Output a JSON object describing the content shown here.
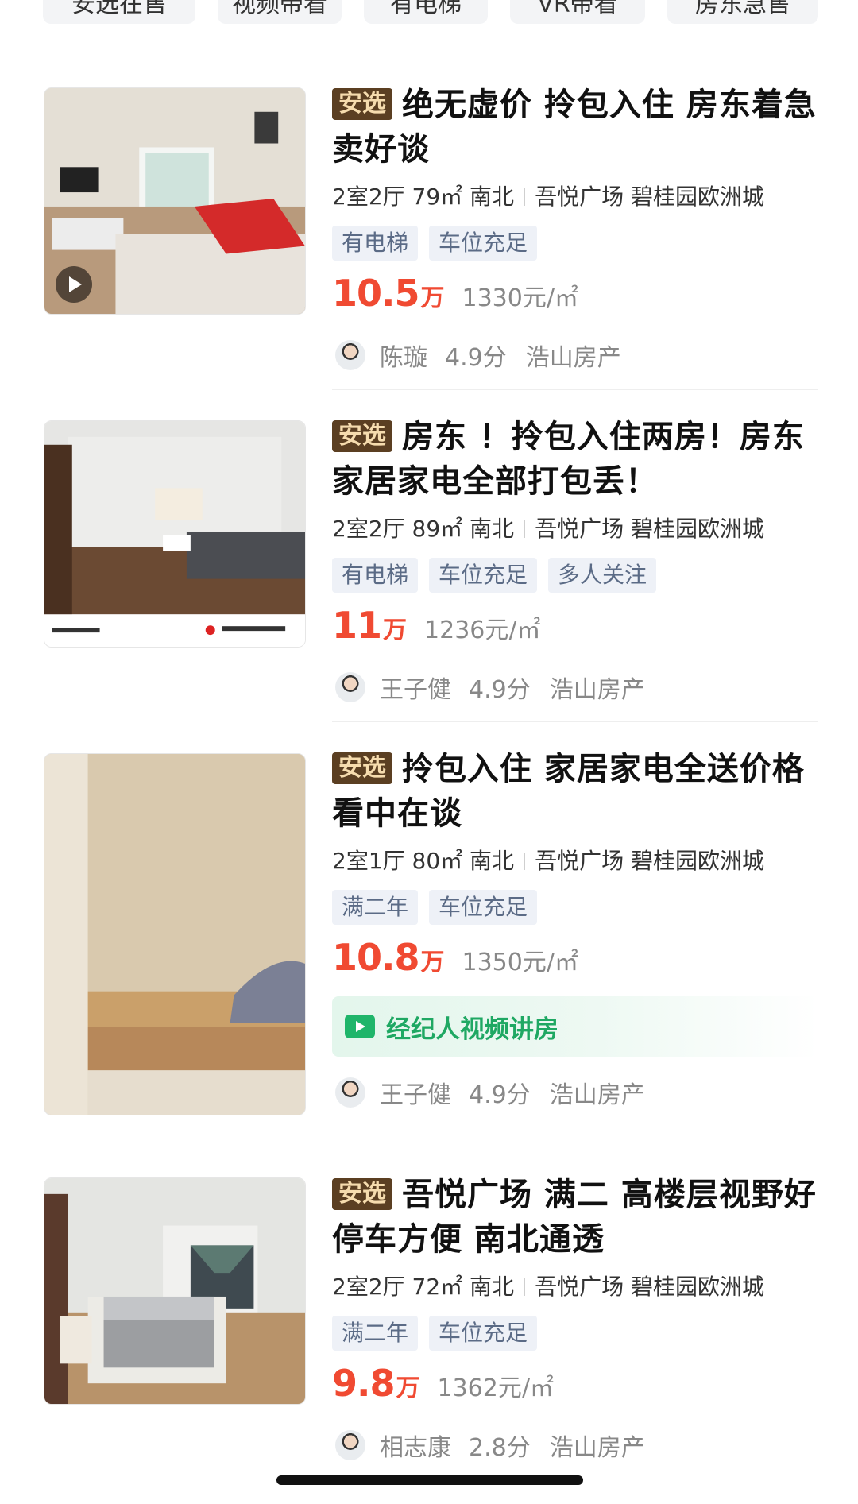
{
  "filters": [
    "安选在售",
    "视频带看",
    "有电梯",
    "VR带看",
    "房东急售"
  ],
  "listings": [
    {
      "badge": "安选",
      "title": "绝无虚价  拎包入住 房东着急卖好谈",
      "layout": "2室2厅 79㎡ 南北",
      "community": "吾悦广场 碧桂园欧洲城",
      "tags": [
        "有电梯",
        "车位充足"
      ],
      "price": "10.5",
      "price_unit": "万",
      "unit_price": "1330元/㎡",
      "has_video_thumb": true,
      "agent": {
        "name": "陈璇",
        "score": "4.9分",
        "agency": "浩山房产"
      }
    },
    {
      "badge": "安选",
      "title": "房东  ！拎包入住两房！房东家居家电全部打包丢！",
      "layout": "2室2厅 89㎡ 南北",
      "community": "吾悦广场 碧桂园欧洲城",
      "tags": [
        "有电梯",
        "车位充足",
        "多人关注"
      ],
      "price": "11",
      "price_unit": "万",
      "unit_price": "1236元/㎡",
      "has_video_thumb": false,
      "agent": {
        "name": "王子健",
        "score": "4.9分",
        "agency": "浩山房产"
      }
    },
    {
      "badge": "安选",
      "title": "拎包入住 家居家电全送价格看中在谈",
      "layout": "2室1厅 80㎡ 南北",
      "community": "吾悦广场 碧桂园欧洲城",
      "tags": [
        "满二年",
        "车位充足"
      ],
      "price": "10.8",
      "price_unit": "万",
      "unit_price": "1350元/㎡",
      "video_banner": "经纪人视频讲房",
      "has_video_thumb": false,
      "agent": {
        "name": "王子健",
        "score": "4.9分",
        "agency": "浩山房产"
      }
    },
    {
      "badge": "安选",
      "title": "吾悦广场 满二  高楼层视野好 停车方便 南北通透",
      "layout": "2室2厅 72㎡ 南北",
      "community": "吾悦广场 碧桂园欧洲城",
      "tags": [
        "满二年",
        "车位充足"
      ],
      "price": "9.8",
      "price_unit": "万",
      "unit_price": "1362元/㎡",
      "has_video_thumb": false,
      "agent": {
        "name": "相志康",
        "score": "2.8分",
        "agency": "浩山房产"
      }
    }
  ],
  "colors": {
    "price": "#f04a32",
    "badge_bg": "#5b3f22",
    "badge_fg": "#f6dcae",
    "tag_bg": "#eef1f7",
    "tag_fg": "#5b6b86",
    "video_green": "#1fa863"
  }
}
